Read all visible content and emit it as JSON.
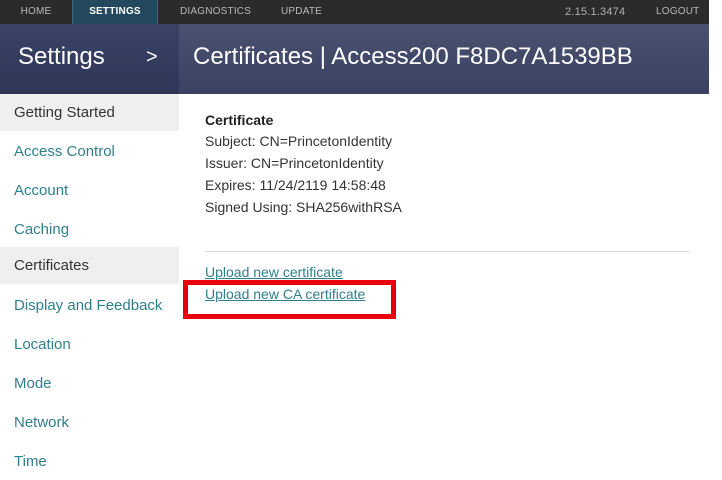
{
  "topnav": {
    "home": "HOME",
    "settings": "SETTINGS",
    "diagnostics": "DIAGNOSTICS",
    "update": "UPDATE",
    "version": "2.15.1.3474",
    "logout": "LOGOUT"
  },
  "header": {
    "settings_label": "Settings",
    "chevron": ">",
    "title": "Certificates | Access200 F8DC7A1539BB"
  },
  "sidebar": {
    "items": [
      {
        "label": "Getting Started"
      },
      {
        "label": "Access Control"
      },
      {
        "label": "Account"
      },
      {
        "label": "Caching"
      },
      {
        "label": "Certificates"
      },
      {
        "label": "Display and Feedback"
      },
      {
        "label": "Location"
      },
      {
        "label": "Mode"
      },
      {
        "label": "Network"
      },
      {
        "label": "Time"
      }
    ]
  },
  "certificate": {
    "heading": "Certificate",
    "subject": "Subject: CN=PrincetonIdentity",
    "issuer": "Issuer: CN=PrincetonIdentity",
    "expires": "Expires: 11/24/2119 14:58:48",
    "signed_using": "Signed Using: SHA256withRSA"
  },
  "actions": {
    "upload_cert": "Upload new certificate",
    "upload_ca_cert": "Upload new CA certificate"
  },
  "colors": {
    "accent_link": "#2f7f8a",
    "highlight": "#e8000b",
    "header_bg": "#3a4161"
  }
}
